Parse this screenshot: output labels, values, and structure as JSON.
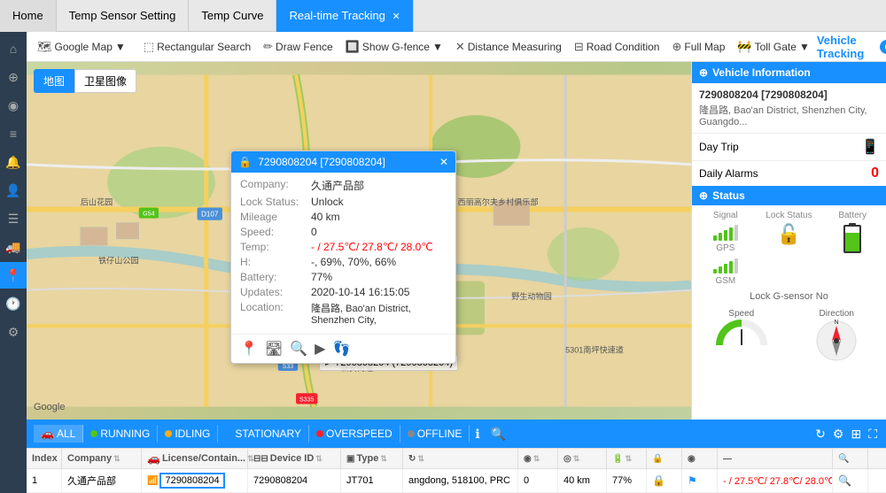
{
  "tabs": [
    {
      "label": "Home",
      "active": false
    },
    {
      "label": "Temp Sensor Setting",
      "active": false
    },
    {
      "label": "Temp Curve",
      "active": false
    },
    {
      "label": "Real-time Tracking",
      "active": true,
      "closable": true
    }
  ],
  "toolbar": {
    "google_map": "Google Map",
    "rectangular_search": "Rectangular Search",
    "draw_fence": "Draw Fence",
    "show_gfence": "Show G-fence",
    "distance_measuring": "Distance Measuring",
    "road_condition": "Road Condition",
    "full_map": "Full Map",
    "toll_gate": "Toll Gate",
    "vehicle_tracking": "Vehicle Tracking"
  },
  "map": {
    "type_map": "地图",
    "type_satellite": "卫星图像",
    "google_watermark": "Google"
  },
  "popup": {
    "title": "7290808204 [7290808204]",
    "company_label": "Company:",
    "company_value": "久通产品部",
    "lock_label": "Lock Status:",
    "lock_value": "Unlock",
    "mileage_label": "Mileage",
    "mileage_value": "40 km",
    "speed_label": "Speed:",
    "speed_value": "0",
    "temp_label": "Temp:",
    "temp_value": "- / 27.5℃/ 27.8℃/ 28.0℃",
    "h_label": "H:",
    "h_value": "-, 69%, 70%, 66%",
    "battery_label": "Battery:",
    "battery_value": "77%",
    "updates_label": "Updates:",
    "updates_value": "2020-10-14 16:15:05",
    "location_label": "Location:",
    "location_value": "隆昌路, Bao'an District, Shenzhen City,"
  },
  "vehicle_info": {
    "header": "Vehicle Information",
    "id": "7290808204 [7290808204]",
    "address": "隆昌路, Bao'an District, Shenzhen City, Guangdo...",
    "day_trip": "Day Trip",
    "daily_alarms": "Daily Alarms",
    "alarms_count": "0",
    "status_header": "Status",
    "signal_label": "Signal",
    "lock_status_label": "Lock Status",
    "battery_label": "Battery",
    "gps_label": "GPS",
    "gsm_label": "GSM",
    "lock_gsensor_label": "Lock G-sensor",
    "lock_gsensor_value": "No",
    "speed_label": "Speed",
    "direction_label": "Direction"
  },
  "bottom_bar": {
    "all": "ALL",
    "running": "RUNNING",
    "idling": "IDLING",
    "stationary": "STATIONARY",
    "overspeed": "OVERSPEED",
    "offline": "OFFLINE"
  },
  "table": {
    "headers": [
      {
        "key": "index",
        "label": "Index"
      },
      {
        "key": "company",
        "label": "Company"
      },
      {
        "key": "license",
        "label": "License/Contain..."
      },
      {
        "key": "deviceid",
        "label": "Device ID"
      },
      {
        "key": "type",
        "label": "Type"
      },
      {
        "key": "addr",
        "label": ""
      },
      {
        "key": "speed",
        "label": ""
      },
      {
        "key": "mileage",
        "label": ""
      },
      {
        "key": "battery",
        "label": ""
      },
      {
        "key": "lock",
        "label": ""
      },
      {
        "key": "status",
        "label": ""
      },
      {
        "key": "temp",
        "label": ""
      },
      {
        "key": "action",
        "label": ""
      }
    ],
    "rows": [
      {
        "index": "1",
        "company": "久通产品部",
        "license": "7290808204",
        "deviceid": "7290808204",
        "type": "JT701",
        "addr": "angdong, 518100, PRC",
        "speed": "0",
        "mileage": "40 km",
        "battery": "77%",
        "lock": "",
        "status": "",
        "temp": "- / 27.5℃/ 27.8℃/ 28.0℃",
        "action": ""
      }
    ]
  },
  "sidebar_icons": [
    "home",
    "search",
    "map",
    "layers",
    "bell",
    "user",
    "settings",
    "truck",
    "car",
    "clock",
    "cog"
  ],
  "colors": {
    "primary": "#1890ff",
    "running": "#52c41a",
    "idling": "#faad14",
    "stationary": "#1890ff",
    "overspeed": "#f5222d",
    "offline": "#888"
  }
}
